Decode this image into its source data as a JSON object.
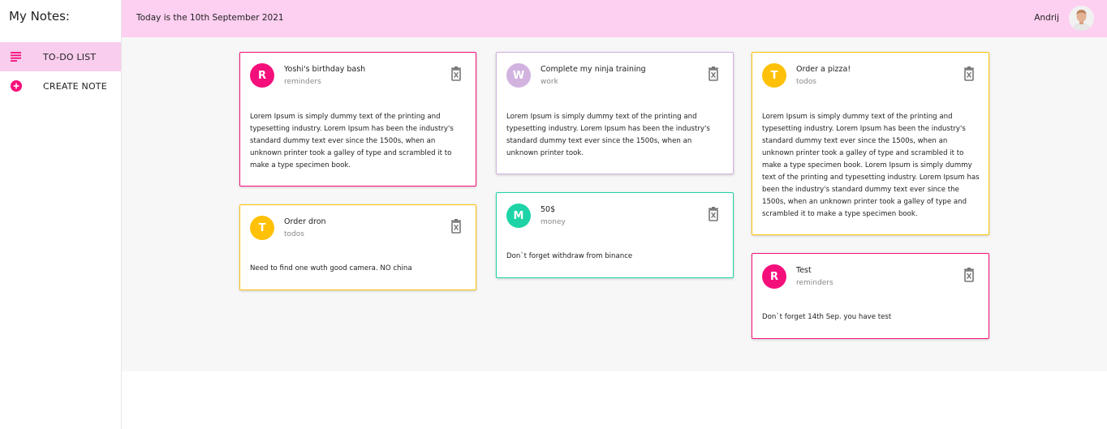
{
  "colors": {
    "pink": "#f50f7b",
    "purple": "#d2b3e0",
    "amber": "#ffc108",
    "teal": "#1ed4a6",
    "active_nav": "#f9cded",
    "topbar": "#fdcff0"
  },
  "sidebar": {
    "title": "My Notes:",
    "items": [
      {
        "label": "TO-DO LIST",
        "icon": "list-icon",
        "active": true
      },
      {
        "label": "CREATE NOTE",
        "icon": "add-circle-icon",
        "active": false
      }
    ]
  },
  "header": {
    "date_text": "Today is the 10th September 2021",
    "user_name": "Andrij",
    "avatar_icon": "user-avatar"
  },
  "notes": [
    {
      "initial": "R",
      "title": "Yoshi's birthday bash",
      "category": "reminders",
      "color": "#f50f7b",
      "body": "Lorem Ipsum is simply dummy text of the printing and typesetting industry. Lorem Ipsum has been the industry's standard dummy text ever since the 1500s, when an unknown printer took a galley of type and scrambled it to make a type specimen book."
    },
    {
      "initial": "W",
      "title": "Complete my ninja training",
      "category": "work",
      "color": "#d2b3e0",
      "body": "Lorem Ipsum is simply dummy text of the printing and typesetting industry. Lorem Ipsum has been the industry's standard dummy text ever since the 1500s, when an unknown printer took."
    },
    {
      "initial": "T",
      "title": "Order a pizza!",
      "category": "todos",
      "color": "#ffc108",
      "body": "Lorem Ipsum is simply dummy text of the printing and typesetting industry. Lorem Ipsum has been the industry's standard dummy text ever since the 1500s, when an unknown printer took a galley of type and scrambled it to make a type specimen book. Lorem Ipsum is simply dummy text of the printing and typesetting industry. Lorem Ipsum has been the industry's standard dummy text ever since the 1500s, when an unknown printer took a galley of type and scrambled it to make a type specimen book."
    },
    {
      "initial": "T",
      "title": "Order dron",
      "category": "todos",
      "color": "#ffc108",
      "body": "Need to find one wuth good camera. NO china"
    },
    {
      "initial": "M",
      "title": "50$",
      "category": "money",
      "color": "#1ed4a6",
      "body": "Don`t forget withdraw from binance"
    },
    {
      "initial": "R",
      "title": "Test",
      "category": "reminders",
      "color": "#f50f7b",
      "body": "Don`t forget 14th Sep. you have test"
    }
  ]
}
